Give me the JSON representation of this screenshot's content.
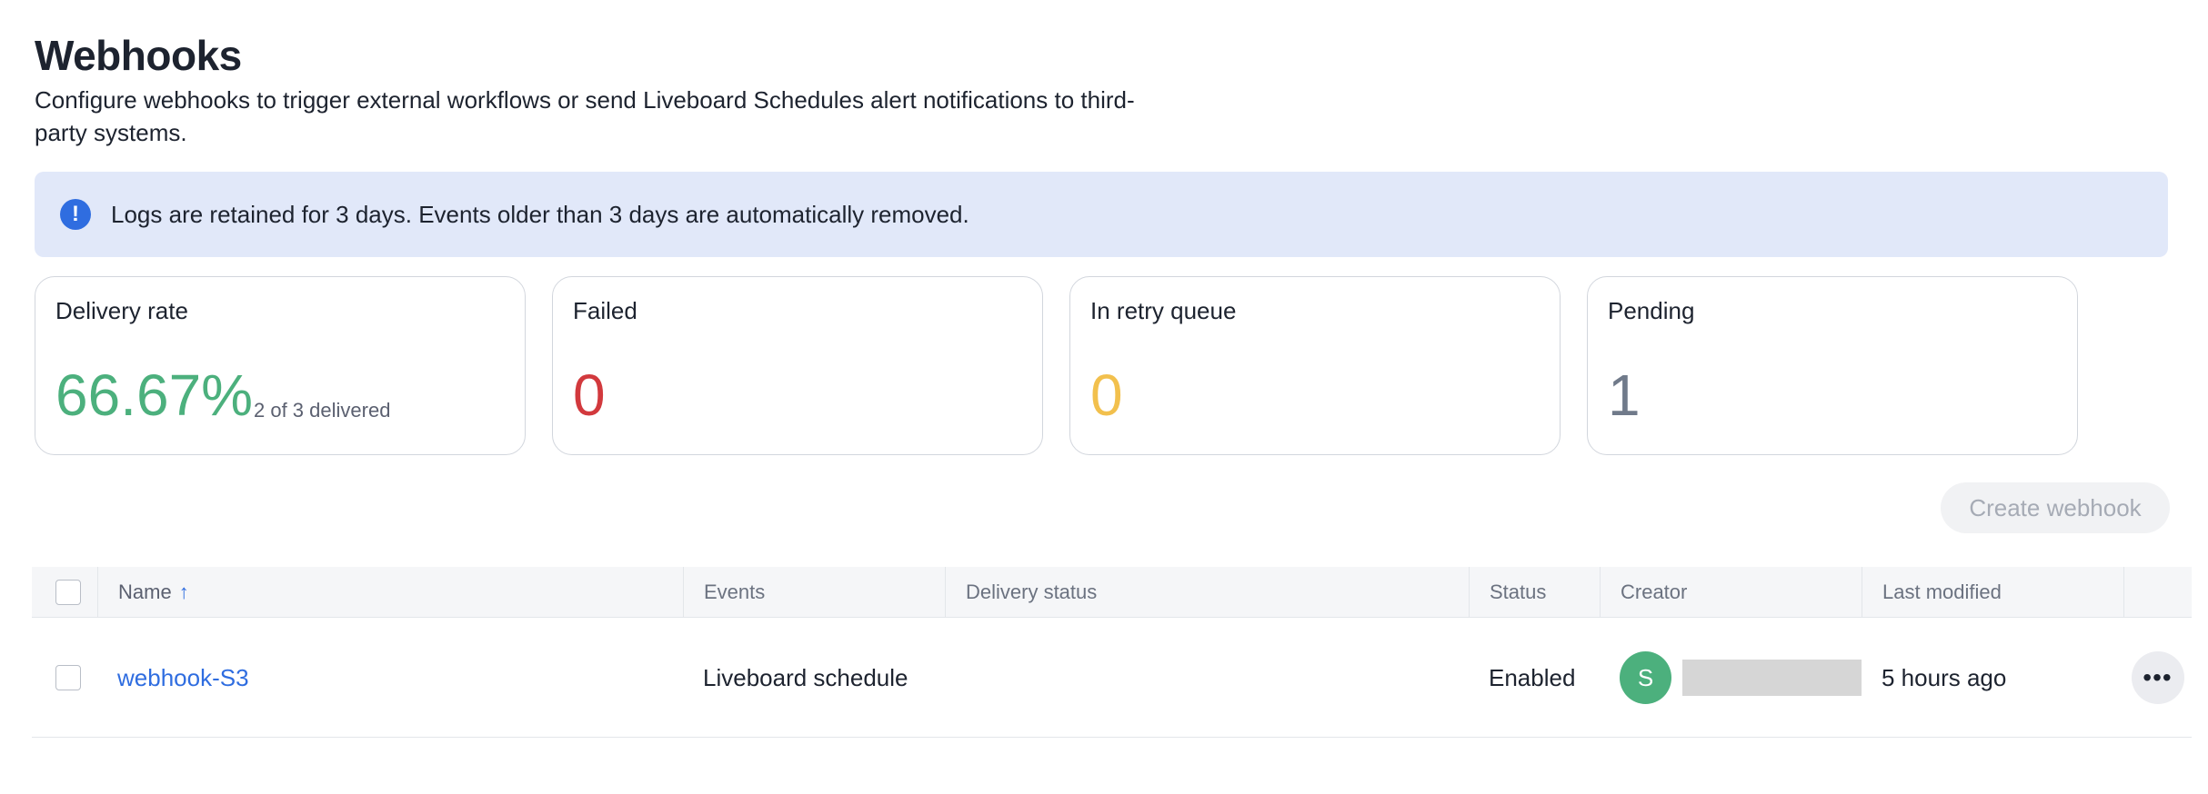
{
  "header": {
    "title": "Webhooks",
    "subtitle": "Configure webhooks to trigger external workflows or send Liveboard Schedules alert notifications to third-party systems."
  },
  "banner": {
    "icon": "info-icon",
    "text": "Logs are retained for 3 days. Events older than 3 days are automatically removed."
  },
  "stats": [
    {
      "label": "Delivery rate",
      "value": "66.67%",
      "sub": "2 of 3 delivered",
      "color": "#4cb07d"
    },
    {
      "label": "Failed",
      "value": "0",
      "color": "#d2393d"
    },
    {
      "label": "In retry queue",
      "value": "0",
      "color": "#f2c04d"
    },
    {
      "label": "Pending",
      "value": "1",
      "color": "#707a8a"
    }
  ],
  "toolbar": {
    "create_label": "Create webhook"
  },
  "table": {
    "columns": {
      "name": "Name",
      "sort_icon": "↑",
      "events": "Events",
      "delivery_status": "Delivery status",
      "status": "Status",
      "creator": "Creator",
      "last_modified": "Last modified"
    },
    "rows": [
      {
        "name": "webhook-S3",
        "events": "Liveboard schedule",
        "delivery_status": "",
        "status": "Enabled",
        "creator_initial": "S",
        "last_modified": "5 hours ago",
        "more_icon": "•••"
      }
    ]
  }
}
